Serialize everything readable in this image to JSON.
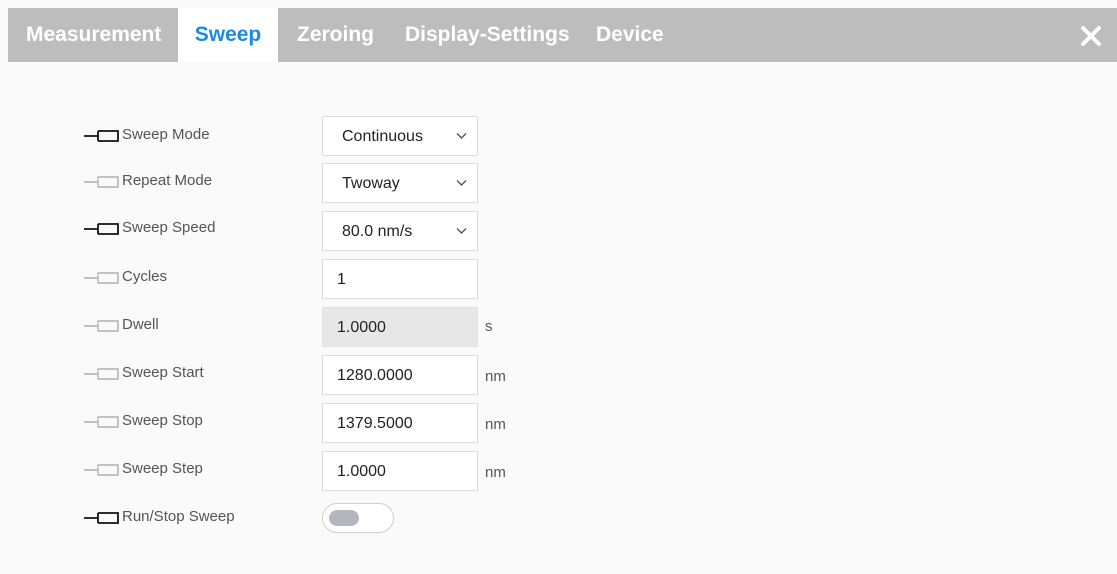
{
  "tabs": [
    {
      "label": "Measurement",
      "active": false
    },
    {
      "label": "Sweep",
      "active": true
    },
    {
      "label": "Zeroing",
      "active": false
    },
    {
      "label": "Display-Settings",
      "active": false
    },
    {
      "label": "Device",
      "active": false
    }
  ],
  "colors": {
    "tabbar_bg": "#bdbdbd",
    "active_tab_text": "#1e88e5",
    "pin_active": "#111111",
    "pin_inactive": "#b0b0b0"
  },
  "close_icon": "close-icon",
  "fields": {
    "sweep_mode": {
      "label": "Sweep Mode",
      "value": "Continuous",
      "pinned": true
    },
    "repeat_mode": {
      "label": "Repeat Mode",
      "value": "Twoway",
      "pinned": false
    },
    "sweep_speed": {
      "label": "Sweep Speed",
      "value": "80.0 nm/s",
      "pinned": true
    },
    "cycles": {
      "label": "Cycles",
      "value": "1",
      "pinned": false
    },
    "dwell": {
      "label": "Dwell",
      "value": "1.0000",
      "unit": "s",
      "pinned": false
    },
    "sweep_start": {
      "label": "Sweep Start",
      "value": "1280.0000",
      "unit": "nm",
      "pinned": false
    },
    "sweep_stop": {
      "label": "Sweep Stop",
      "value": "1379.5000",
      "unit": "nm",
      "pinned": false
    },
    "sweep_step": {
      "label": "Sweep Step",
      "value": "1.0000",
      "unit": "nm",
      "pinned": false
    },
    "run_stop": {
      "label": "Run/Stop Sweep",
      "state": "off",
      "pinned": true
    }
  }
}
